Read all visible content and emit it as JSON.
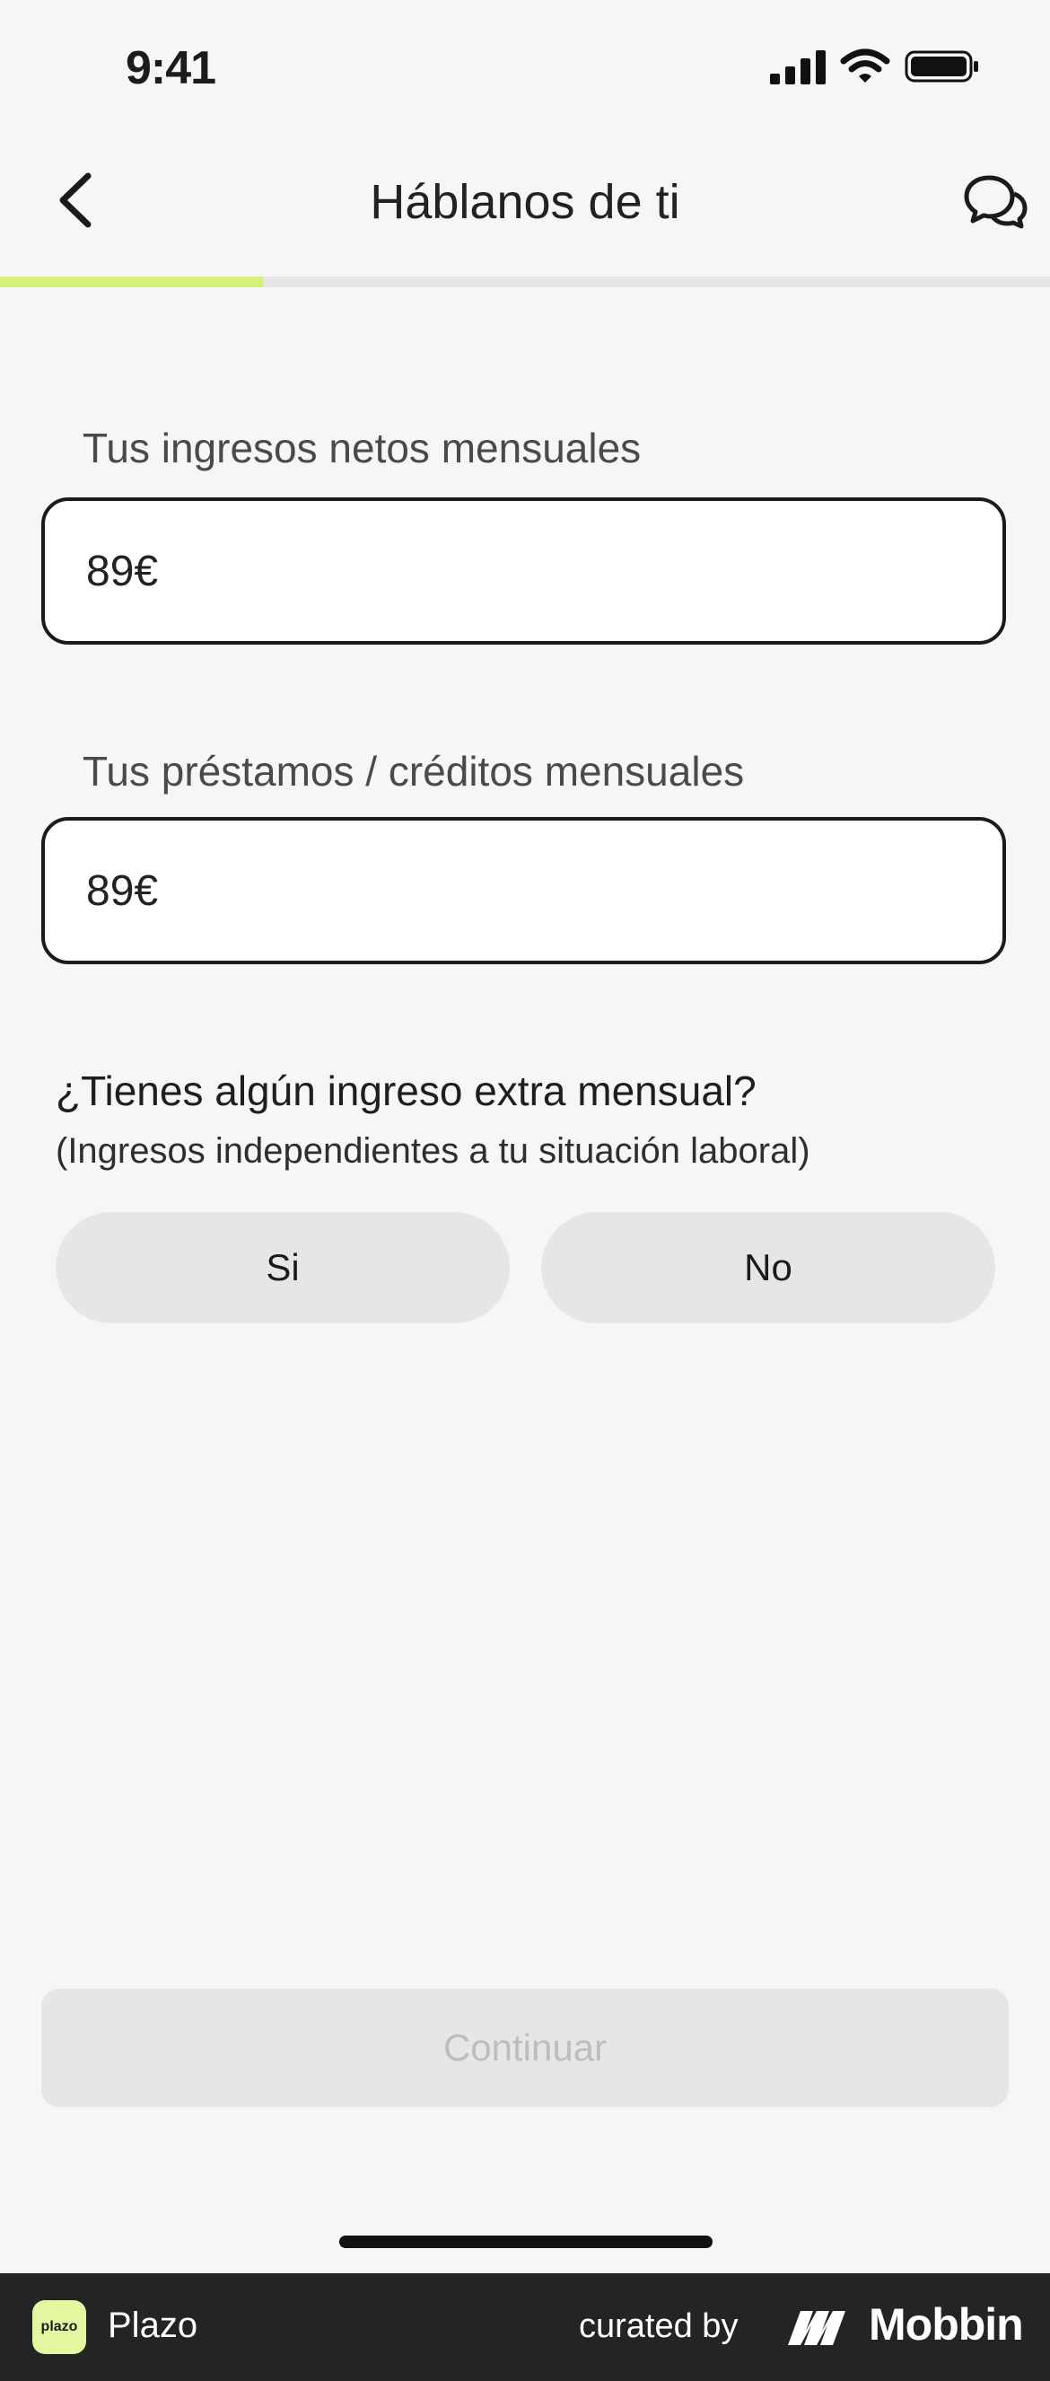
{
  "status_bar": {
    "time": "9:41"
  },
  "header": {
    "title": "Háblanos de ti",
    "progress": 0.25
  },
  "form": {
    "income_label": "Tus ingresos netos mensuales",
    "income_value": "89€",
    "loans_label": "Tus préstamos / créditos mensuales",
    "loans_value": "89€",
    "extra_question": "¿Tienes algún ingreso extra mensual?",
    "extra_hint": "(Ingresos independientes a tu situación laboral)",
    "yes_label": "Si",
    "no_label": "No"
  },
  "actions": {
    "continue_label": "Continuar"
  },
  "footer": {
    "app_logo_text": "plazo",
    "app_name": "Plazo",
    "curated_by": "curated by",
    "brand": "Mobbin"
  },
  "colors": {
    "background": "#f6f6f6",
    "accent": "#d6f07e",
    "border": "#1b1b1b",
    "disabled": "#e6e6e6",
    "footer": "#242424"
  }
}
